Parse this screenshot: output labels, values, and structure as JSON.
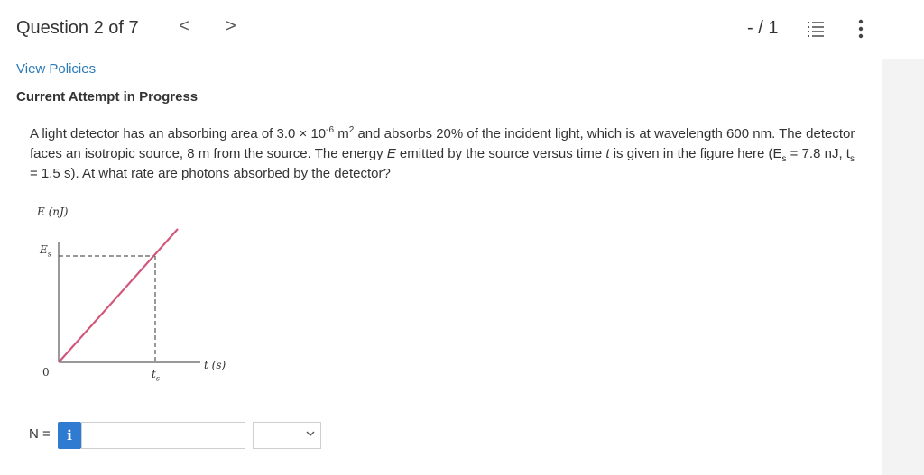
{
  "header": {
    "question_label": "Question 2 of 7",
    "prev_icon": "chevron-left-icon",
    "next_icon": "chevron-right-icon",
    "prev_glyph": "<",
    "next_glyph": ">",
    "score": "- / 1",
    "list_icon": "numbered-list-icon",
    "more_icon": "more-vertical-icon"
  },
  "policies": {
    "link_label": "View Policies"
  },
  "attempt": {
    "status": "Current Attempt in Progress"
  },
  "question": {
    "part1": "A light detector has an absorbing area of 3.0 × 10",
    "exp1": "-6",
    "part2": " m",
    "exp2": "2",
    "part3": " and absorbs 20% of the incident light, which is at wavelength 600 nm. The detector faces an isotropic source, 8 m from the source. The energy ",
    "E": "E",
    "part4": " emitted by the source versus time ",
    "t": "t",
    "part5": " is given in the figure here (E",
    "sub_s1": "s",
    "part6": " = 7.8 nJ, t",
    "sub_s2": "s",
    "part7": " = 1.5 s). At what rate are photons absorbed by the detector?"
  },
  "figure": {
    "y_axis_label": "E (nJ)",
    "es_label": "E",
    "es_sub": "s",
    "origin_label": "0",
    "ts_label": "t",
    "ts_sub": "s",
    "x_axis_label": "t (s)",
    "line_color": "#d2577a"
  },
  "answer": {
    "variable_label": "N =",
    "info_label": "i",
    "input_value": "",
    "unit_selected": ""
  }
}
